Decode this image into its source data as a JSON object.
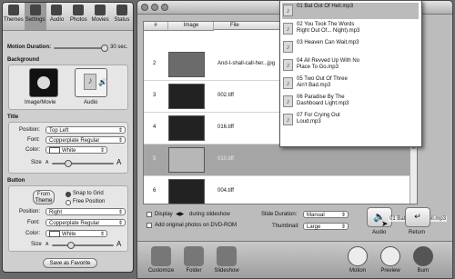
{
  "left_panel": {
    "tabs": [
      {
        "label": "Themes",
        "icon": "themes-icon"
      },
      {
        "label": "Settings",
        "icon": "gear-icon"
      },
      {
        "label": "Audio",
        "icon": "music-note-icon"
      },
      {
        "label": "Photos",
        "icon": "photo-icon"
      },
      {
        "label": "Movies",
        "icon": "film-icon"
      },
      {
        "label": "Status",
        "icon": "status-icon"
      }
    ],
    "motion_duration_label": "Motion Duration:",
    "motion_duration_value": "30 sec.",
    "motion_duration_level": 0.95,
    "background_label": "Background",
    "image_movie_label": "Image/Movie",
    "audio_label": "Audio",
    "title_section_label": "Title",
    "position_label": "Position:",
    "title_position": "Top Left",
    "font_label": "Font:",
    "title_font": "Copperplate Regular",
    "color_label": "Color:",
    "title_color": "White",
    "size_label": "Size",
    "size_small_glyph": "A",
    "size_large_glyph": "A",
    "title_size_level": 0.25,
    "button_section_label": "Button",
    "from_theme_label": "From Theme",
    "snap_to_grid_label": "Snap to Grid",
    "free_position_label": "Free Position",
    "button_position": "Right",
    "button_font": "Copperplate Regular",
    "button_color": "White",
    "button_size_level": 0.3,
    "save_favorite_label": "Save as Favorite"
  },
  "main_window": {
    "table_headers": {
      "number": "#",
      "image": "Image",
      "file": "File"
    },
    "rows": [
      {
        "num": "2",
        "file": "And-I-shall-call-her...jpg",
        "selected": false
      },
      {
        "num": "3",
        "file": "002.tiff",
        "selected": false
      },
      {
        "num": "4",
        "file": "016.tiff",
        "selected": false
      },
      {
        "num": "5",
        "file": "010.tiff",
        "selected": true
      },
      {
        "num": "6",
        "file": "004.tiff",
        "selected": false
      }
    ],
    "display_label": "Display",
    "display_label_rest": "during slideshow",
    "add_originals_label": "Add original photos on DVD-ROM",
    "slide_duration_label": "Slide Duration:",
    "slide_duration_value": "Manual",
    "thumbnail_label": "Thumbnail:",
    "thumbnail_value": "Large",
    "audio_button_label": "Audio",
    "return_button_label": "Return",
    "drag_tooltip": "01 Bat Out Of Hell.mp3"
  },
  "audio_list": [
    {
      "line1": "01 Bat Out Of Hell.mp3",
      "line2": ""
    },
    {
      "line1": "02 You Took The Words",
      "line2": "Right Out Of... Night).mp3"
    },
    {
      "line1": "03 Heaven Can Wait.mp3",
      "line2": ""
    },
    {
      "line1": "04 All Revved Up With No",
      "line2": "Place To Go.mp3"
    },
    {
      "line1": "05 Two Out Of Three",
      "line2": "Ain't Bad.mp3"
    },
    {
      "line1": "06 Paradise By The",
      "line2": "Dashboard Light.mp3"
    },
    {
      "line1": "07 For Crying Out",
      "line2": "Loud.mp3"
    }
  ],
  "toolbar": {
    "customize": "Customize",
    "folder": "Folder",
    "slideshow": "Slideshow",
    "motion": "Motion",
    "preview": "Preview",
    "burn": "Burn"
  }
}
